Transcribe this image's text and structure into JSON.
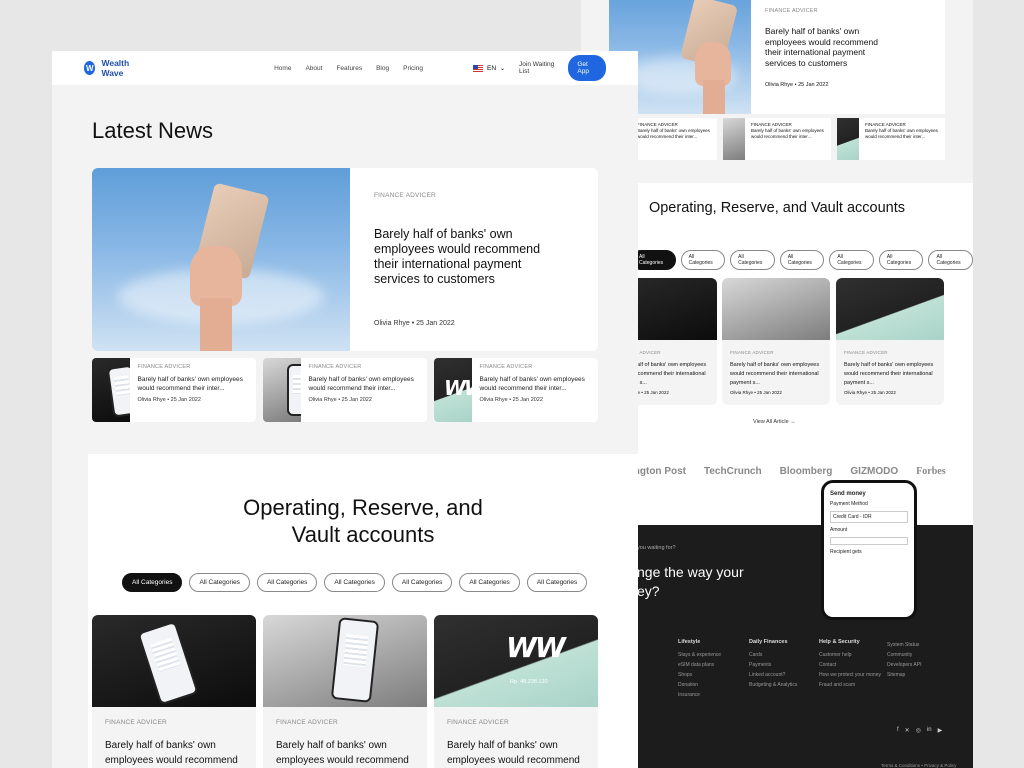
{
  "nav": {
    "brand": "Wealth Wave",
    "links": [
      "Home",
      "About",
      "Features",
      "Blog",
      "Pricing"
    ],
    "lang": "EN",
    "join": "Join Waiting List",
    "cta": "Get App"
  },
  "news": {
    "title": "Latest News",
    "featured": {
      "tag": "FINANCE ADVICER",
      "title": "Barely half of banks' own employees would recommend their international payment services to customers",
      "author": "Olivia Rhye • 25 Jan 2022"
    },
    "small": [
      {
        "tag": "FINANCE ADVICER",
        "title": "Barely half of banks' own employees would recommend their inter...",
        "author": "Olivia Rhye • 25 Jan 2022"
      },
      {
        "tag": "FINANCE ADVICER",
        "title": "Barely half of banks' own employees would recommend their inter...",
        "author": "Olivia Rhye • 25 Jan 2022"
      },
      {
        "tag": "FINANCE ADVICER",
        "title": "Barely half of banks' own employees would recommend their inter...",
        "author": "Olivia Rhye • 25 Jan 2022"
      }
    ]
  },
  "accounts": {
    "title": "Operating, Reserve, and Vault accounts",
    "chips": [
      "All Categories",
      "All Categories",
      "All Categories",
      "All Categories",
      "All Categories",
      "All Categories",
      "All Categories"
    ],
    "cards": [
      {
        "tag": "FINANCE ADVICER",
        "title": "Barely half of banks' own employees would recommend"
      },
      {
        "tag": "FINANCE ADVICER",
        "title": "Barely half of banks' own employees would recommend"
      },
      {
        "tag": "FINANCE ADVICER",
        "title": "Barely half of banks' own employees would recommend"
      }
    ],
    "cards2": [
      {
        "tag": "FINANCE ADVICER",
        "title": "Barely half of banks' own employees would recommend their international payment s...",
        "author": "Olivia Rhye • 25 Jan 2022"
      },
      {
        "tag": "FINANCE ADVICER",
        "title": "Barely half of banks' own employees would recommend their international payment s...",
        "author": "Olivia Rhye • 25 Jan 2022"
      },
      {
        "tag": "FINANCE ADVICER",
        "title": "Barely half of banks' own employees would recommend their international payment s...",
        "author": "Olivia Rhye • 25 Jan 2022"
      }
    ],
    "view_all": "View All Article →",
    "amount": "Rp. 48.238.120"
  },
  "logos": [
    "ington Post",
    "TechCrunch",
    "Bloomberg",
    "GIZMODO",
    "Forbes"
  ],
  "footer": {
    "question": "you waiting for?",
    "cta": "nge the way your ey?",
    "phone": {
      "title": "Send money",
      "method": "Payment Method",
      "card": "Credit Card - IDR",
      "amount": "Amount",
      "recipient": "Recipient gets"
    },
    "cols": [
      {
        "head": "Lifestyle",
        "items": [
          "Stays & experience",
          "eSIM data plans",
          "Shops",
          "Donation",
          "Insurance"
        ]
      },
      {
        "head": "Daily Finances",
        "items": [
          "Cards",
          "Payments",
          "Linked account?",
          "Budgeting & Analytics"
        ]
      },
      {
        "head": "Help & Security",
        "items": [
          "Customer help",
          "Contact",
          "How we protect your money",
          "Fraud and scam"
        ]
      },
      {
        "head": "",
        "items": [
          "System Status",
          "Community",
          "Developers API",
          "Sitemap"
        ]
      }
    ],
    "legal": "Terms & Conditions  •  Privacy & Policy"
  }
}
